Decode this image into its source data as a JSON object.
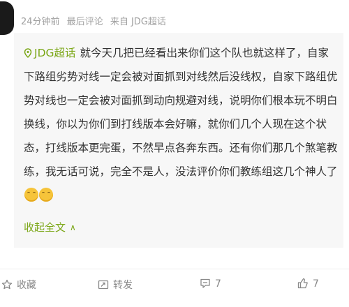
{
  "post": {
    "meta": {
      "time": "24分钟前",
      "last_comment": "最后评论",
      "source": "来自 JDG超话"
    },
    "topic_tag": "JDG超话",
    "text_lines": [
      "就今天几把已经看出来你们这个队也就这样了，自家下路组劣势对",
      "线一定会被对面抓到对线然后没线权，自家下路组优势对线也一定会被对面抓到",
      "动向规避对线，说明你们根本玩不明白换线，你以为你们到打线版本会好嘛，就",
      "你们几个人现在这个状态，打线版本更完蛋，不然早点各奔东西。还有你们那几",
      "个煞笔教练，我无话可说，完全不是人，没法评价你们教练组这几个神人了"
    ],
    "emoji": "smile-emoji",
    "collapse_label": "收起全文",
    "collapse_icon": "chevron-up-icon"
  },
  "actions": {
    "favorite": "收藏",
    "repost": "转发",
    "comment_count": "7",
    "like_count": "7"
  },
  "colors": {
    "accent": "#7aa615",
    "text": "#333333",
    "meta": "#a0a0a0",
    "card_bg": "#f7f7f7",
    "action": "#888888"
  }
}
